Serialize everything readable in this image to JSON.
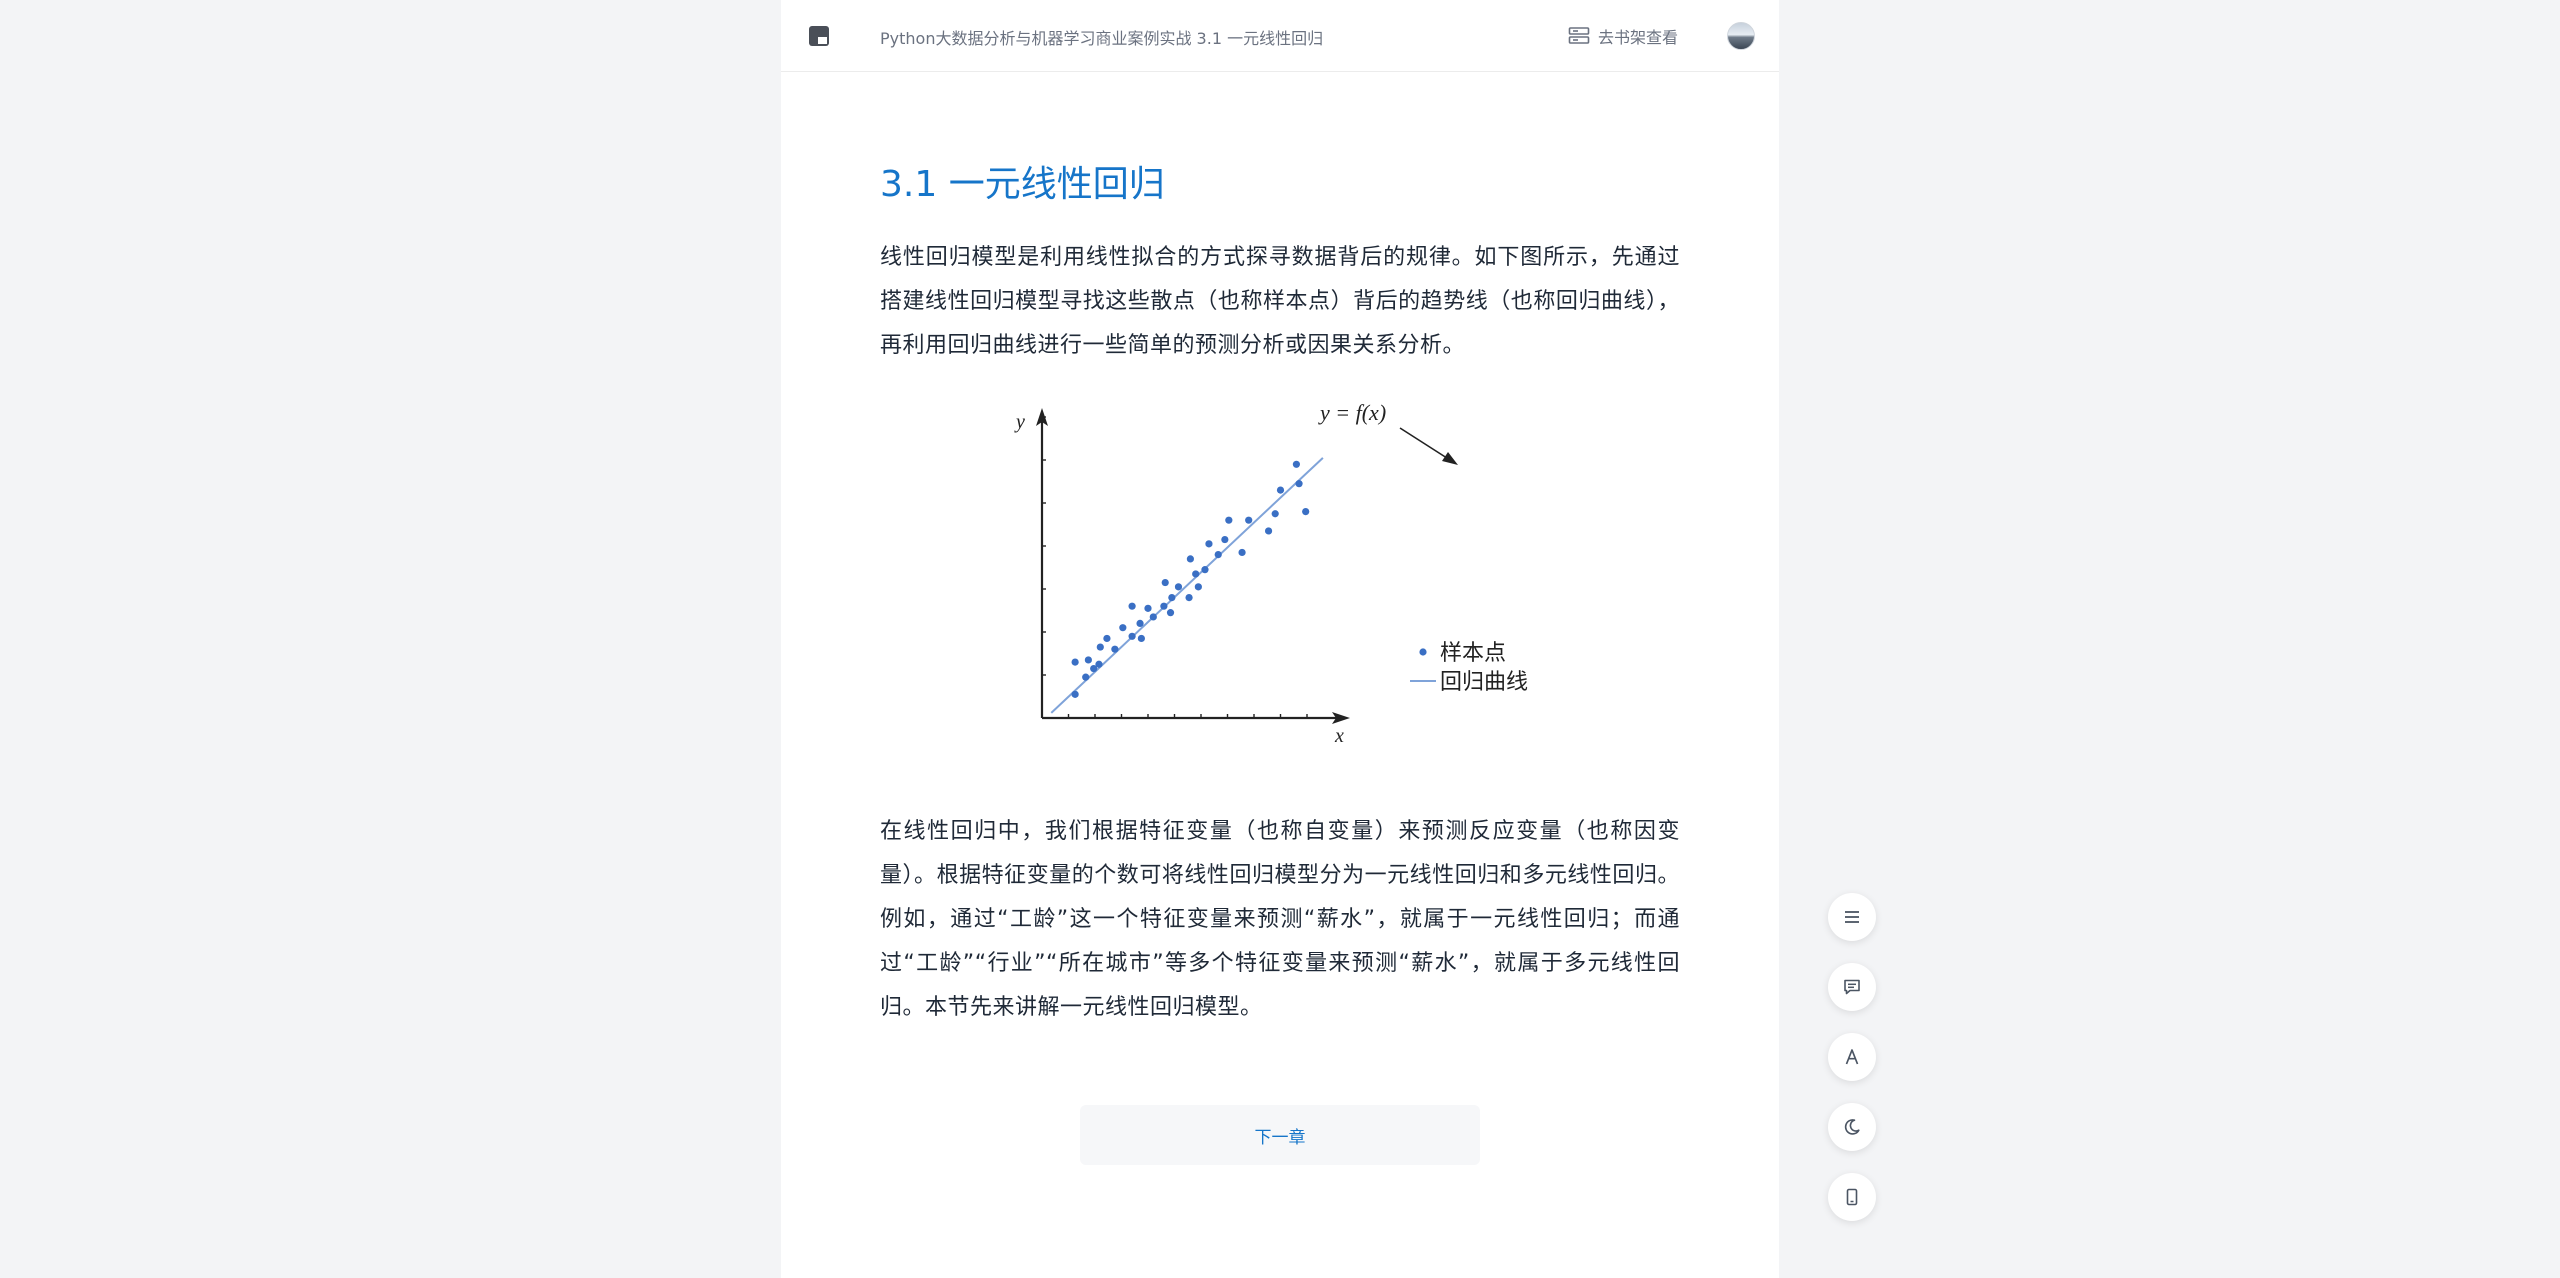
{
  "header": {
    "book_title": "Python大数据分析与机器学习商业案例实战 3.1 一元线性回归",
    "shelf_label": "去书架查看"
  },
  "main": {
    "chapter_title": "3.1 一元线性回归",
    "paragraph_1": "线性回归模型是利用线性拟合的方式探寻数据背后的规律。如下图所示，先通过搭建线性回归模型寻找这些散点（也称样本点）背后的趋势线（也称回归曲线），再利用回归曲线进行一些简单的预测分析或因果关系分析。",
    "paragraph_2": "在线性回归中，我们根据特征变量（也称自变量）来预测反应变量（也称因变量）。根据特征变量的个数可将线性回归模型分为一元线性回归和多元线性回归。例如，通过“工龄”这一个特征变量来预测“薪水”，就属于一元线性回归；而通过“工龄”“行业”“所在城市”等多个特征变量来预测“薪水”，就属于多元线性回归。本节先来讲解一元线性回归模型。",
    "next_chapter_label": "下一章"
  },
  "chart_data": {
    "type": "scatter",
    "xlabel": "x",
    "ylabel": "y",
    "xlim": [
      0,
      11
    ],
    "ylim": [
      0,
      7.5
    ],
    "annotation": "y = f(x)",
    "legend": {
      "placement": "bottom-right",
      "entries": [
        "样本点",
        "回归曲线"
      ]
    },
    "series": [
      {
        "name": "样本点",
        "kind": "points",
        "x": [
          1.25,
          1.25,
          1.65,
          1.75,
          1.95,
          2.15,
          2.2,
          2.45,
          2.75,
          3.05,
          3.4,
          3.4,
          3.7,
          3.75,
          4.0,
          4.2,
          4.6,
          4.65,
          4.85,
          4.9,
          5.15,
          5.55,
          5.6,
          5.8,
          5.9,
          6.15,
          6.3,
          6.65,
          6.9,
          7.05,
          7.55,
          7.8,
          8.55,
          8.8,
          9.0,
          9.7,
          9.95,
          9.6
        ],
        "y": [
          0.55,
          1.3,
          0.95,
          1.35,
          1.15,
          1.25,
          1.65,
          1.85,
          1.6,
          2.1,
          1.9,
          2.6,
          2.2,
          1.85,
          2.55,
          2.35,
          2.6,
          3.15,
          2.45,
          2.8,
          3.05,
          2.8,
          3.7,
          3.35,
          3.05,
          3.45,
          4.05,
          3.8,
          4.15,
          4.6,
          3.85,
          4.6,
          4.35,
          4.75,
          5.3,
          5.45,
          4.8,
          5.9
        ]
      },
      {
        "name": "回归曲线",
        "kind": "line",
        "x": [
          0.35,
          10.6
        ],
        "y": [
          0.12,
          6.05
        ]
      }
    ]
  },
  "icons": {
    "logo": "reader-logo-icon",
    "shelf": "bookshelf-icon",
    "tools": [
      "menu-icon",
      "comment-icon",
      "font-icon",
      "night-mode-icon",
      "phone-icon"
    ]
  },
  "colors": {
    "accent": "#1675c9",
    "point": "#3a6fc4",
    "line": "#7fa3d9"
  }
}
